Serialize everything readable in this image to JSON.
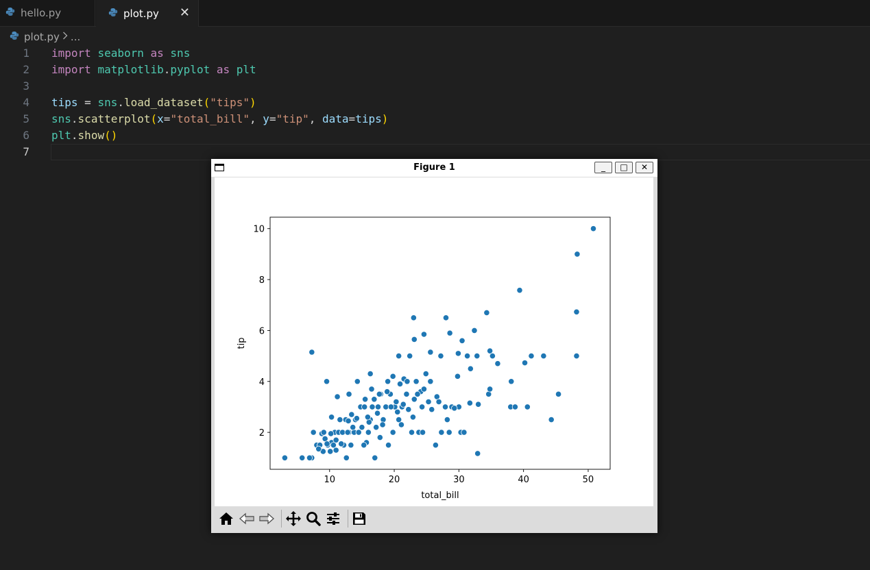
{
  "tabs": [
    {
      "label": "hello.py",
      "active": false
    },
    {
      "label": "plot.py",
      "active": true,
      "close": "✕"
    }
  ],
  "breadcrumb": {
    "file": "plot.py",
    "more": "..."
  },
  "editor": {
    "line_numbers": [
      "1",
      "2",
      "3",
      "4",
      "5",
      "6",
      "7"
    ],
    "current_line": 7,
    "tokens": {
      "l1": {
        "kw1": "import",
        "mod": "seaborn",
        "kw2": "as",
        "alias": "sns"
      },
      "l2": {
        "kw1": "import",
        "mod": "matplotlib",
        "dot": ".",
        "sub": "pyplot",
        "kw2": "as",
        "alias": "plt"
      },
      "l4": {
        "var": "tips",
        "eq": " = ",
        "obj": "sns",
        "dot": ".",
        "fn": "load_dataset",
        "lp": "(",
        "str": "\"tips\"",
        "rp": ")"
      },
      "l5": {
        "obj": "sns",
        "dot": ".",
        "fn": "scatterplot",
        "lp": "(",
        "px": "x",
        "eq1": "=",
        "sx": "\"total_bill\"",
        "c1": ", ",
        "py": "y",
        "eq2": "=",
        "sy": "\"tip\"",
        "c2": ", ",
        "pd": "data",
        "eq3": "=",
        "vd": "tips",
        "rp": ")"
      },
      "l6": {
        "obj": "plt",
        "dot": ".",
        "fn": "show",
        "lp": "(",
        "rp": ")"
      }
    }
  },
  "figure_window": {
    "title": "Figure 1",
    "minimize": "_",
    "maximize": "□",
    "close": "✕",
    "toolbar": [
      "home-icon",
      "back-icon",
      "forward-icon",
      "pan-icon",
      "zoom-icon",
      "configure-icon",
      "save-icon"
    ]
  },
  "colors": {
    "point": "#1f77b4",
    "background": "#1f1f1f"
  },
  "chart_data": {
    "type": "scatter",
    "xlabel": "total_bill",
    "ylabel": "tip",
    "xlim": [
      0.8,
      53.4
    ],
    "ylim": [
      0.55,
      10.45
    ],
    "xticks": [
      10,
      20,
      30,
      40,
      50
    ],
    "yticks": [
      2,
      4,
      6,
      8,
      10
    ],
    "grid": false,
    "points": [
      [
        3.07,
        1.0
      ],
      [
        5.75,
        1.0
      ],
      [
        7.25,
        1.0
      ],
      [
        12.6,
        1.0
      ],
      [
        17.0,
        1.0
      ],
      [
        7.25,
        5.15
      ],
      [
        9.55,
        4.0
      ],
      [
        11.2,
        3.4
      ],
      [
        13.0,
        3.5
      ],
      [
        14.3,
        4.0
      ],
      [
        16.3,
        4.3
      ],
      [
        19.8,
        4.2
      ],
      [
        20.7,
        5.0
      ],
      [
        22.4,
        5.0
      ],
      [
        23.1,
        5.65
      ],
      [
        24.6,
        5.85
      ],
      [
        25.6,
        5.15
      ],
      [
        27.2,
        5.0
      ],
      [
        28.6,
        5.9
      ],
      [
        29.9,
        5.1
      ],
      [
        30.5,
        5.6
      ],
      [
        31.3,
        5.0
      ],
      [
        32.4,
        6.0
      ],
      [
        32.8,
        5.0
      ],
      [
        34.8,
        5.2
      ],
      [
        35.2,
        5.0
      ],
      [
        36.0,
        4.7
      ],
      [
        40.2,
        4.73
      ],
      [
        41.2,
        5.0
      ],
      [
        43.1,
        5.0
      ],
      [
        48.2,
        5.0
      ],
      [
        23.0,
        6.5
      ],
      [
        28.0,
        6.5
      ],
      [
        34.3,
        6.7
      ],
      [
        48.2,
        6.73
      ],
      [
        39.4,
        7.58
      ],
      [
        48.3,
        9.0
      ],
      [
        50.8,
        10.0
      ],
      [
        7.5,
        2.0
      ],
      [
        8.0,
        1.5
      ],
      [
        8.5,
        1.5
      ],
      [
        9.0,
        1.25
      ],
      [
        9.3,
        1.75
      ],
      [
        9.7,
        1.5
      ],
      [
        10.1,
        1.25
      ],
      [
        10.3,
        1.6
      ],
      [
        10.6,
        1.5
      ],
      [
        10.3,
        2.6
      ],
      [
        10.8,
        2.0
      ],
      [
        11.0,
        1.7
      ],
      [
        11.4,
        2.0
      ],
      [
        11.6,
        2.5
      ],
      [
        12.0,
        2.0
      ],
      [
        12.2,
        1.5
      ],
      [
        12.5,
        2.5
      ],
      [
        13.0,
        2.0
      ],
      [
        13.3,
        1.5
      ],
      [
        13.4,
        2.7
      ],
      [
        13.8,
        2.0
      ],
      [
        14.0,
        2.5
      ],
      [
        14.5,
        2.0
      ],
      [
        14.8,
        3.0
      ],
      [
        15.0,
        2.2
      ],
      [
        15.4,
        3.0
      ],
      [
        15.7,
        1.6
      ],
      [
        16.0,
        2.0
      ],
      [
        16.3,
        2.5
      ],
      [
        16.6,
        3.0
      ],
      [
        16.5,
        3.7
      ],
      [
        16.9,
        3.3
      ],
      [
        17.2,
        2.2
      ],
      [
        17.5,
        3.0
      ],
      [
        17.8,
        1.8
      ],
      [
        17.9,
        3.5
      ],
      [
        18.3,
        2.5
      ],
      [
        18.7,
        3.0
      ],
      [
        19.1,
        1.5
      ],
      [
        19.4,
        3.5
      ],
      [
        19.8,
        2.0
      ],
      [
        20.1,
        3.0
      ],
      [
        20.3,
        3.2
      ],
      [
        20.7,
        2.5
      ],
      [
        20.9,
        3.9
      ],
      [
        21.2,
        3.0
      ],
      [
        21.5,
        4.1
      ],
      [
        21.9,
        3.5
      ],
      [
        22.2,
        2.9
      ],
      [
        22.7,
        2.0
      ],
      [
        23.1,
        3.3
      ],
      [
        23.4,
        4.0
      ],
      [
        23.8,
        2.0
      ],
      [
        24.1,
        3.6
      ],
      [
        24.3,
        3.0
      ],
      [
        24.6,
        3.7
      ],
      [
        24.9,
        4.3
      ],
      [
        25.3,
        3.2
      ],
      [
        25.6,
        4.0
      ],
      [
        26.4,
        1.5
      ],
      [
        26.6,
        3.4
      ],
      [
        27.3,
        2.0
      ],
      [
        27.9,
        3.0
      ],
      [
        28.2,
        2.5
      ],
      [
        28.5,
        2.0
      ],
      [
        28.9,
        3.0
      ],
      [
        29.8,
        4.2
      ],
      [
        30.0,
        3.0
      ],
      [
        30.3,
        2.0
      ],
      [
        30.8,
        2.0
      ],
      [
        31.7,
        3.15
      ],
      [
        31.8,
        4.5
      ],
      [
        32.9,
        1.17
      ],
      [
        33.0,
        3.1
      ],
      [
        34.6,
        3.5
      ],
      [
        34.8,
        3.7
      ],
      [
        38.1,
        4.0
      ],
      [
        38.0,
        3.0
      ],
      [
        38.7,
        3.0
      ],
      [
        40.6,
        3.0
      ],
      [
        44.3,
        2.5
      ],
      [
        45.4,
        3.5
      ],
      [
        6.9,
        1.0
      ],
      [
        8.3,
        1.35
      ],
      [
        8.8,
        1.95
      ],
      [
        9.6,
        1.55
      ],
      [
        10.2,
        1.95
      ],
      [
        11.8,
        1.55
      ],
      [
        12.8,
        2.0
      ],
      [
        13.6,
        2.2
      ],
      [
        14.2,
        2.55
      ],
      [
        15.3,
        1.5
      ],
      [
        16.1,
        2.4
      ],
      [
        17.4,
        2.75
      ],
      [
        18.2,
        2.3
      ],
      [
        18.9,
        3.6
      ],
      [
        19.5,
        3.0
      ],
      [
        20.5,
        2.8
      ],
      [
        21.1,
        2.3
      ],
      [
        22.0,
        4.0
      ],
      [
        22.9,
        2.6
      ],
      [
        23.6,
        3.5
      ],
      [
        24.4,
        2.0
      ],
      [
        25.8,
        2.9
      ],
      [
        26.9,
        3.2
      ],
      [
        29.3,
        2.95
      ],
      [
        9.1,
        2.0
      ],
      [
        11.0,
        1.3
      ],
      [
        12.9,
        2.45
      ],
      [
        15.9,
        2.6
      ],
      [
        17.7,
        3.5
      ],
      [
        19.0,
        4.0
      ],
      [
        21.4,
        3.1
      ],
      [
        15.5,
        3.3
      ]
    ]
  }
}
